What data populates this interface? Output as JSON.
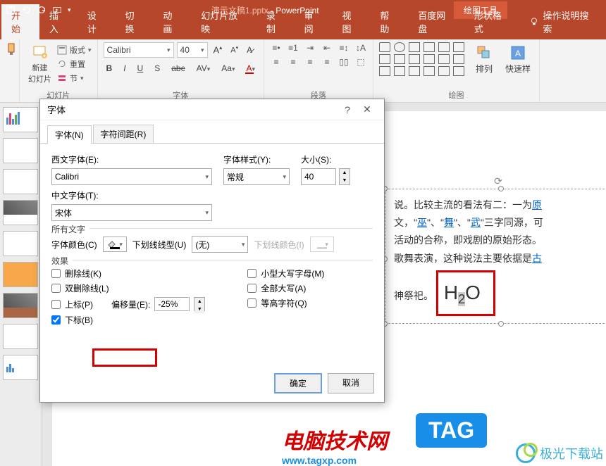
{
  "app": {
    "doc_name": "演示文稿1.pptx",
    "app_name": "PowerPoint",
    "context_tool_group": "绘图工具",
    "tell_me": "操作说明搜索"
  },
  "tabs": {
    "home": "开始",
    "insert": "插入",
    "design": "设计",
    "transition": "切换",
    "animation": "动画",
    "slideshow": "幻灯片放映",
    "record": "录制",
    "review": "审阅",
    "view": "视图",
    "help": "帮助",
    "baidu": "百度网盘",
    "shape_format": "形状格式"
  },
  "ribbon": {
    "slides": {
      "new_slide": "新建\n幻灯片",
      "layout": "版式",
      "reset": "重置",
      "section": "节",
      "group": "幻灯片"
    },
    "font": {
      "family": "Calibri",
      "size": "40",
      "group": "字体"
    },
    "para": {
      "group": "段落"
    },
    "draw": {
      "arrange": "排列",
      "quick": "快速样",
      "group": "绘图"
    }
  },
  "dialog": {
    "title": "字体",
    "tab_font": "字体(N)",
    "tab_spacing": "字符间距(R)",
    "latin_label": "西文字体(E):",
    "latin_value": "Calibri",
    "style_label": "字体样式(Y):",
    "style_value": "常规",
    "size_label": "大小(S):",
    "size_value": "40",
    "asian_label": "中文字体(T):",
    "asian_value": "宋体",
    "all_text": "所有文字",
    "font_color_label": "字体颜色(C)",
    "underline_style_label": "下划线线型(U)",
    "underline_style_value": "(无)",
    "underline_color_label": "下划线颜色(I)",
    "effects": "效果",
    "strike": "删除线(K)",
    "dstrike": "双删除线(L)",
    "superscript": "上标(P)",
    "offset_label": "偏移量(E):",
    "offset_value": "-25%",
    "subscript": "下标(B)",
    "smallcaps": "小型大写字母(M)",
    "allcaps": "全部大写(A)",
    "equalize": "等高字符(Q)",
    "ok": "确定",
    "cancel": "取消"
  },
  "slide": {
    "body": "说。比较主流的看法有二：一为",
    "body2a": "文，\"",
    "wu1": "巫",
    "body2b": "\"、\"",
    "wu2": "舞",
    "body2c": "\"、\"",
    "wu3": "武",
    "body2d": "\"三字同源，可",
    "body3": "活动的合称，即戏剧的原始形态。",
    "body4a": "歌舞表演，这种说法主要依据是",
    "gu": "古",
    "body5": "神祭祀。",
    "h": "H",
    "two": "2",
    "o": "O",
    "yuan": "原"
  },
  "watermark": {
    "line1": "电脑技术网",
    "line2": "www.tagxp.com",
    "tag": "TAG",
    "jg": "极光下载站"
  }
}
